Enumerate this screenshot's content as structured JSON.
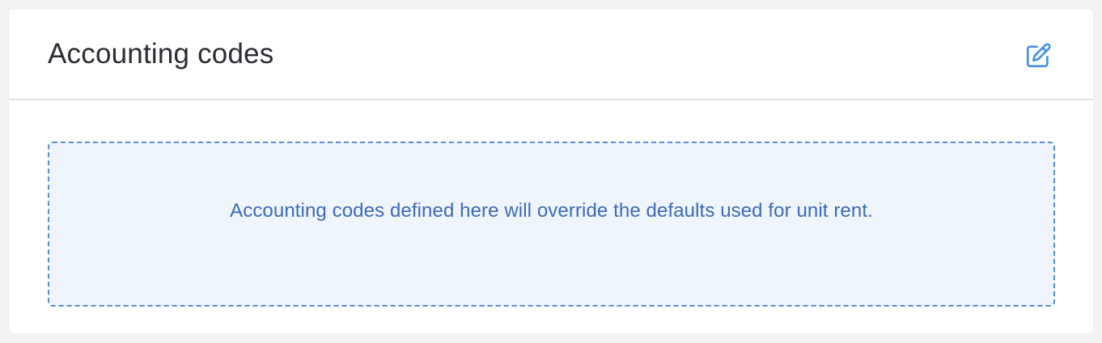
{
  "card": {
    "title": "Accounting codes",
    "edit_icon": "edit-pencil-square-icon",
    "empty_message": "Accounting codes defined here will override the defaults used for unit rent."
  },
  "colors": {
    "accent": "#3c6ab7",
    "icon": "#4a90e2",
    "empty_bg": "#eff5fc",
    "empty_border": "#5b8bd9"
  }
}
